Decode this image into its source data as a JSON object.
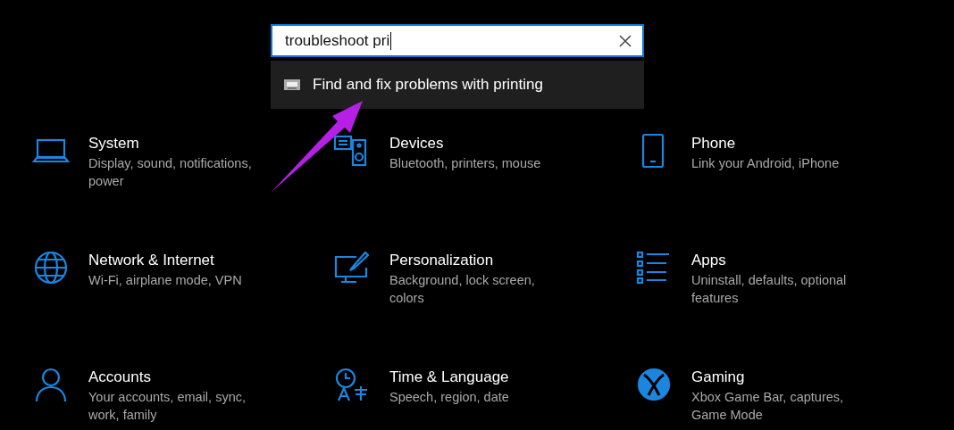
{
  "search": {
    "value": "troubleshoot pri"
  },
  "suggestion": {
    "text": "Find and fix problems with printing"
  },
  "categories": [
    {
      "kind": "laptop",
      "title": "System",
      "subtitle": "Display, sound, notifications, power"
    },
    {
      "kind": "devices",
      "title": "Devices",
      "subtitle": "Bluetooth, printers, mouse"
    },
    {
      "kind": "phone",
      "title": "Phone",
      "subtitle": "Link your Android, iPhone"
    },
    {
      "kind": "globe",
      "title": "Network & Internet",
      "subtitle": "Wi-Fi, airplane mode, VPN"
    },
    {
      "kind": "paint",
      "title": "Personalization",
      "subtitle": "Background, lock screen, colors"
    },
    {
      "kind": "list",
      "title": "Apps",
      "subtitle": "Uninstall, defaults, optional features"
    },
    {
      "kind": "person",
      "title": "Accounts",
      "subtitle": "Your accounts, email, sync, work, family"
    },
    {
      "kind": "clock",
      "title": "Time & Language",
      "subtitle": "Speech, region, date"
    },
    {
      "kind": "xbox",
      "title": "Gaming",
      "subtitle": "Xbox Game Bar, captures, Game Mode"
    }
  ],
  "annotation": {
    "kind": "arrow"
  }
}
